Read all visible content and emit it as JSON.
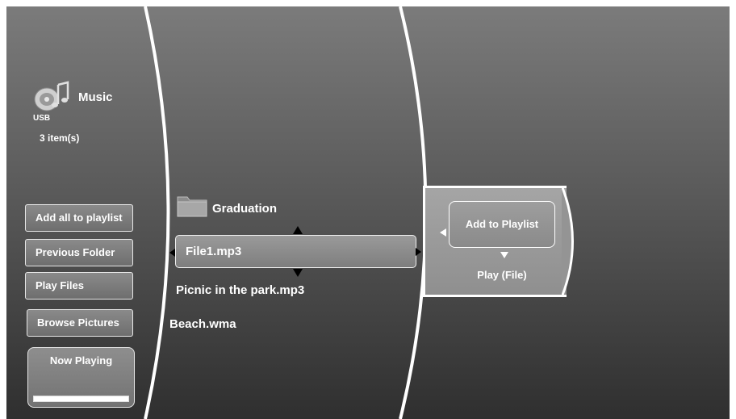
{
  "header": {
    "title": "Music",
    "source": "USB",
    "item_count": "3 item(s)"
  },
  "sidebar": {
    "buttons": [
      {
        "label": "Add all to playlist"
      },
      {
        "label": "Previous Folder"
      },
      {
        "label": "Play Files"
      },
      {
        "label": "Browse Pictures"
      }
    ],
    "now_playing": {
      "label": "Now Playing"
    }
  },
  "file_list": {
    "folder": "Graduation",
    "selected": "File1.mp3",
    "items": [
      "Picnic in the park.mp3",
      "Beach.wma"
    ]
  },
  "context_menu": {
    "selected": "Add to Playlist",
    "option": "Play (File)"
  },
  "icons": {
    "music": "music-disc-icon",
    "folder": "folder-icon"
  }
}
